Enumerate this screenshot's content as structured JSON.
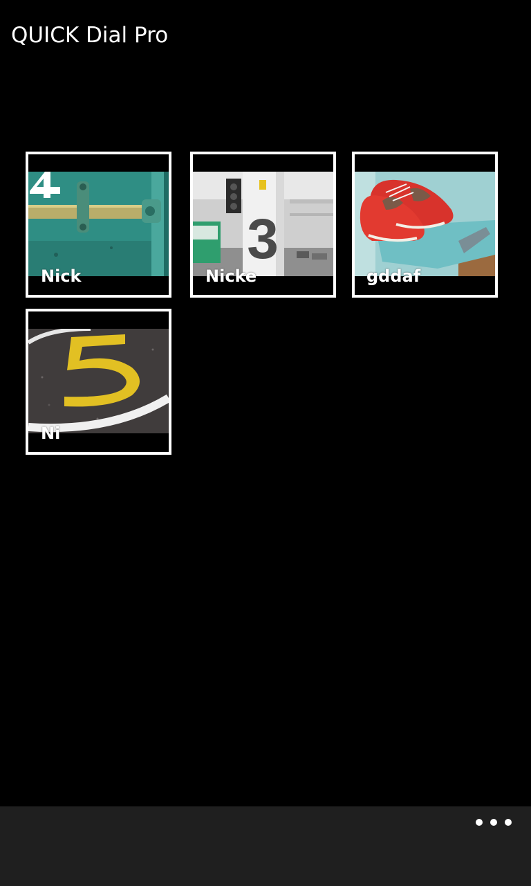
{
  "app": {
    "title": "QUICK Dial Pro"
  },
  "tiles": [
    {
      "name": "Nick",
      "image": "teal-container-door-number-4"
    },
    {
      "name": "Nicke",
      "image": "parking-garage-pillar-number-3"
    },
    {
      "name": "gddaf",
      "image": "red-shoes-on-blue-chair"
    },
    {
      "name": "Ni",
      "image": "asphalt-number-5-painted"
    }
  ],
  "app_bar": {
    "more_icon": "ellipsis-icon"
  },
  "colors": {
    "background": "#000000",
    "app_bar": "#1f1f1f",
    "tile_border": "#ffffff",
    "text": "#ffffff"
  }
}
